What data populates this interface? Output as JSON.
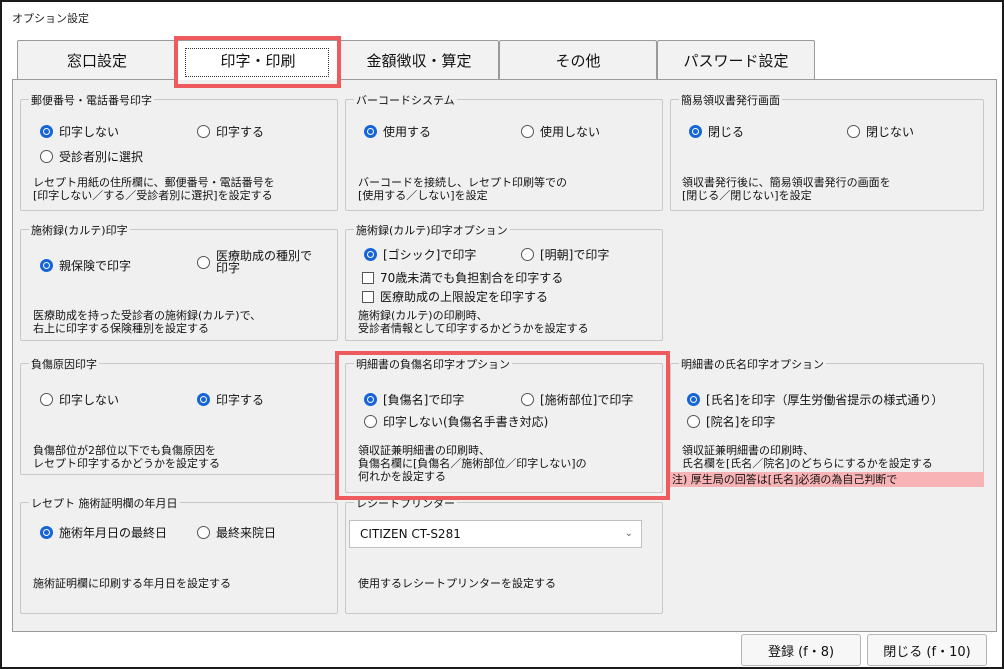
{
  "window": {
    "title": "オプション設定"
  },
  "tabs": [
    {
      "label": "窓口設定"
    },
    {
      "label": "印字・印刷"
    },
    {
      "label": "金額徴収・算定"
    },
    {
      "label": "その他"
    },
    {
      "label": "パスワード設定"
    }
  ],
  "groups": {
    "postal": {
      "title": "郵便番号・電話番号印字",
      "options": [
        "印字しない",
        "印字する",
        "受診者別に選択"
      ],
      "selected": 0,
      "desc": [
        "レセプト用紙の住所欄に、郵便番号・電話番号を",
        "[印字しない／する／受診者別に選択]を設定する"
      ]
    },
    "barcode": {
      "title": "バーコードシステム",
      "options": [
        "使用する",
        "使用しない"
      ],
      "selected": 0,
      "desc": [
        "バーコードを接続し、レセプト印刷等での",
        "[使用する／しない]を設定"
      ]
    },
    "receipt_screen": {
      "title": "簡易領収書発行画面",
      "options": [
        "閉じる",
        "閉じない"
      ],
      "selected": 0,
      "desc": [
        "領収書発行後に、簡易領収書発行の画面を",
        "[閉じる／閉じない]を設定"
      ]
    },
    "karte": {
      "title": "施術録(カルテ)印字",
      "options": [
        "親保険で印字",
        "医療助成の種別で",
        "印字"
      ],
      "selected": 0,
      "desc": [
        "医療助成を持った受診者の施術録(カルテ)で、",
        "右上に印字する保険種別を設定する"
      ]
    },
    "karte_option": {
      "title": "施術録(カルテ)印字オプション",
      "options": [
        "[ゴシック]で印字",
        "[明朝]で印字"
      ],
      "selected": 0,
      "checks": [
        "70歳未満でも負担割合を印字する",
        "医療助成の上限設定を印字する"
      ],
      "desc": [
        "施術録(カルテ)の印刷時、",
        "受診者情報として印字するかどうかを設定する"
      ]
    },
    "injury_cause": {
      "title": "負傷原因印字",
      "options": [
        "印字しない",
        "印字する"
      ],
      "selected": 1,
      "desc": [
        "負傷部位が2部位以下でも負傷原因を",
        "レセプト印字するかどうかを設定する"
      ]
    },
    "injury_name": {
      "title": "明細書の負傷名印字オプション",
      "options": [
        "[負傷名]で印字",
        "[施術部位]で印字",
        "印字しない(負傷名手書き対応)"
      ],
      "selected": 0,
      "desc": [
        "領収証兼明細書の印刷時、",
        "負傷名欄に[負傷名／施術部位／印字しない]の",
        "何れかを設定する"
      ]
    },
    "patient_name": {
      "title": "明細書の氏名印字オプション",
      "options": [
        "[氏名]を印字（厚生労働省提示の様式通り）",
        "[院名]を印字"
      ],
      "selected": 0,
      "desc": [
        "領収証兼明細書の印刷時、",
        "氏名欄を[氏名／院名]のどちらにするかを設定する"
      ],
      "note": "注) 厚生局の回答は[氏名]必須の為自己判断で"
    },
    "receipt_date": {
      "title": "レセプト 施術証明欄の年月日",
      "options": [
        "施術年月日の最終日",
        "最終来院日"
      ],
      "selected": 0,
      "desc": [
        "施術証明欄に印刷する年月日を設定する"
      ]
    },
    "printer": {
      "title": "レシートプリンター",
      "value": "CITIZEN CT-S281",
      "desc": [
        "使用するレシートプリンターを設定する"
      ]
    }
  },
  "buttons": {
    "register": "登録 (f・8)",
    "close": "閉じる (f・10)"
  },
  "colors": {
    "accent": "#1565d8",
    "highlight": "#ef5a5f",
    "note_bg": "#f7b3b5"
  }
}
